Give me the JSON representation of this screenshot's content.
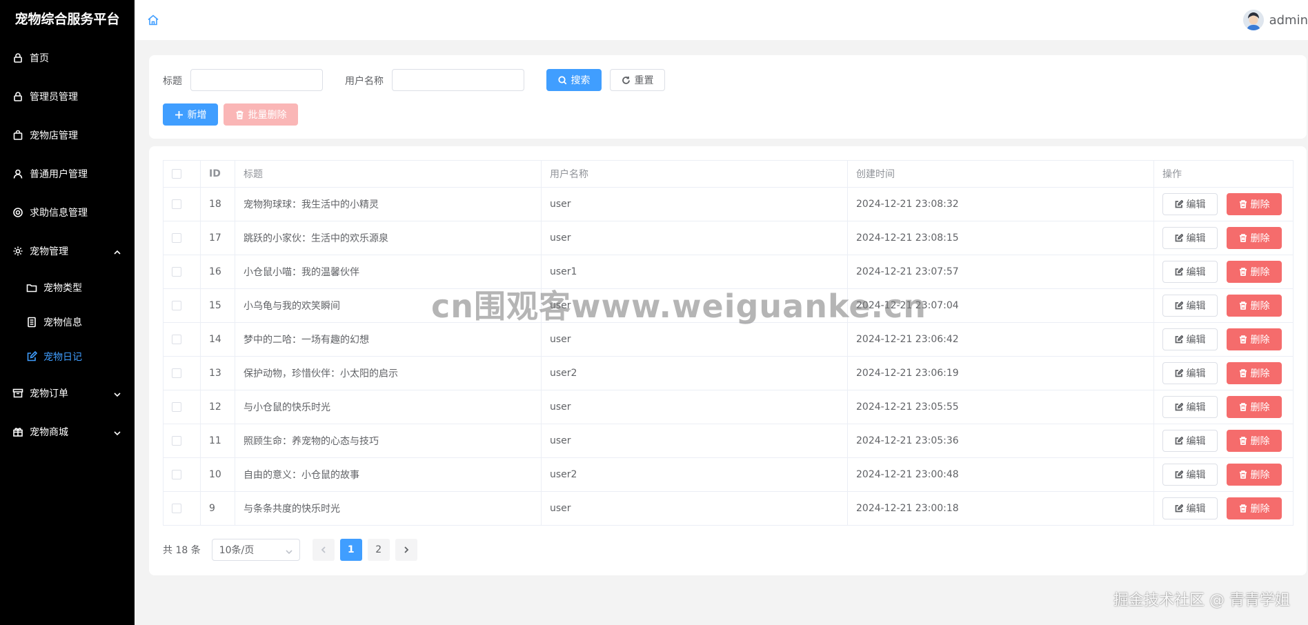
{
  "app_title": "宠物综合服务平台",
  "header": {
    "username": "admin"
  },
  "sidebar": {
    "items": [
      {
        "label": "首页",
        "icon": "lock-icon"
      },
      {
        "label": "管理员管理",
        "icon": "lock-icon"
      },
      {
        "label": "宠物店管理",
        "icon": "shop-icon"
      },
      {
        "label": "普通用户管理",
        "icon": "user-icon"
      },
      {
        "label": "求助信息管理",
        "icon": "lifebuoy-icon"
      },
      {
        "label": "宠物管理",
        "icon": "gear-icon",
        "expanded": true,
        "children": [
          {
            "label": "宠物类型",
            "icon": "folder-icon"
          },
          {
            "label": "宠物信息",
            "icon": "document-icon"
          },
          {
            "label": "宠物日记",
            "icon": "edit-icon",
            "active": true
          }
        ]
      },
      {
        "label": "宠物订单",
        "icon": "box-icon",
        "expanded": false
      },
      {
        "label": "宠物商城",
        "icon": "gift-icon",
        "expanded": false
      }
    ]
  },
  "search": {
    "title_label": "标题",
    "title_value": "",
    "username_label": "用户名称",
    "username_value": "",
    "search_button": "搜索",
    "reset_button": "重置",
    "add_button": "新增",
    "batch_delete_button": "批量删除"
  },
  "table": {
    "columns": [
      "ID",
      "标题",
      "用户名称",
      "创建时间",
      "操作"
    ],
    "edit_label": "编辑",
    "delete_label": "删除",
    "rows": [
      {
        "id": "18",
        "title": "宠物狗球球：我生活中的小精灵",
        "user": "user",
        "created": "2024-12-21 23:08:32"
      },
      {
        "id": "17",
        "title": "跳跃的小家伙：生活中的欢乐源泉",
        "user": "user",
        "created": "2024-12-21 23:08:15"
      },
      {
        "id": "16",
        "title": "小仓鼠小喵：我的温馨伙伴",
        "user": "user1",
        "created": "2024-12-21 23:07:57"
      },
      {
        "id": "15",
        "title": "小乌龟与我的欢笑瞬间",
        "user": "user",
        "created": "2024-12-21 23:07:04"
      },
      {
        "id": "14",
        "title": "梦中的二哈：一场有趣的幻想",
        "user": "user",
        "created": "2024-12-21 23:06:42"
      },
      {
        "id": "13",
        "title": "保护动物，珍惜伙伴：小太阳的启示",
        "user": "user2",
        "created": "2024-12-21 23:06:19"
      },
      {
        "id": "12",
        "title": "与小仓鼠的快乐时光",
        "user": "user",
        "created": "2024-12-21 23:05:55"
      },
      {
        "id": "11",
        "title": "照顾生命：养宠物的心态与技巧",
        "user": "user",
        "created": "2024-12-21 23:05:36"
      },
      {
        "id": "10",
        "title": "自由的意义：小仓鼠的故事",
        "user": "user2",
        "created": "2024-12-21 23:00:48"
      },
      {
        "id": "9",
        "title": "与条条共度的快乐时光",
        "user": "user",
        "created": "2024-12-21 23:00:18"
      }
    ]
  },
  "pagination": {
    "total_text": "共 18 条",
    "page_size": "10条/页",
    "pages": [
      "1",
      "2"
    ],
    "current_page": "1"
  },
  "watermarks": {
    "center": "cn围观客www.weiguanke.cn",
    "corner": "掘金技术社区 @ 青青学姐"
  },
  "colors": {
    "primary": "#409eff",
    "danger": "#f56c6c",
    "sidebar_bg": "#000000"
  }
}
